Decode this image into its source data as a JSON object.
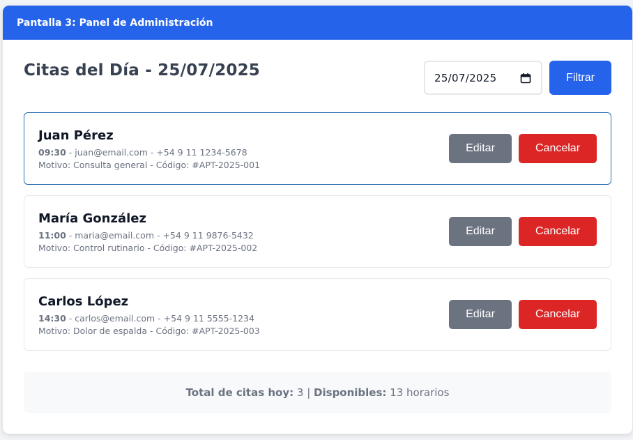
{
  "header": {
    "title": "Pantalla 3: Panel de Administración"
  },
  "main": {
    "title": "Citas del Día - 25/07/2025",
    "date_value": "25/07/2025",
    "filter_label": "Filtrar"
  },
  "appointments": [
    {
      "name": "Juan Pérez",
      "time": "09:30",
      "contact": " - juan@email.com - +54 9 11 1234-5678",
      "details": "Motivo: Consulta general - Código: #APT-2025-001",
      "edit_label": "Editar",
      "cancel_label": "Cancelar"
    },
    {
      "name": "María González",
      "time": "11:00",
      "contact": " - maria@email.com - +54 9 11 9876-5432",
      "details": "Motivo: Control rutinario - Código: #APT-2025-002",
      "edit_label": "Editar",
      "cancel_label": "Cancelar"
    },
    {
      "name": "Carlos López",
      "time": "14:30",
      "contact": " - carlos@email.com - +54 9 11 5555-1234",
      "details": "Motivo: Dolor de espalda - Código: #APT-2025-003",
      "edit_label": "Editar",
      "cancel_label": "Cancelar"
    }
  ],
  "summary": {
    "total_label": "Total de citas hoy:",
    "total_value": " 3 | ",
    "available_label": "Disponibles:",
    "available_value": " 13 horarios"
  },
  "colors": {
    "primary": "#2563eb",
    "edit": "#6b7280",
    "cancel": "#dc2626",
    "selected_border": "#2b6cb0"
  },
  "icons": {
    "date_picker": "calendar-icon"
  }
}
